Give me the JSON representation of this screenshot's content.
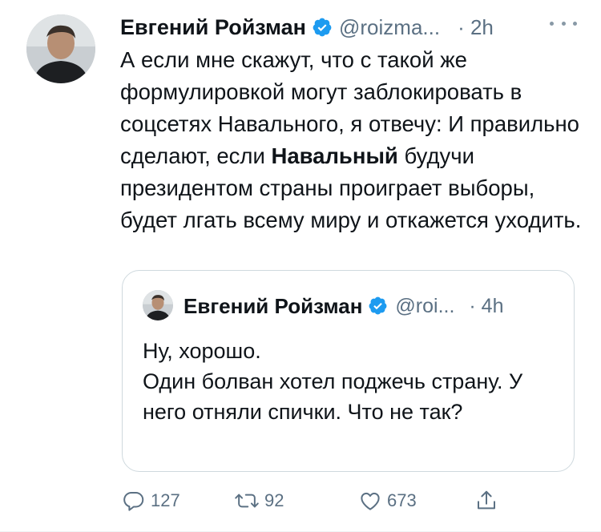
{
  "tweet": {
    "author_name": "Евгений Ройзман",
    "handle": "@roizma...",
    "time": "· 2h",
    "text_before": "А если мне скажут, что с такой же формулировкой  могут заблокировать в соцсетях Навального, я отвечу: И правильно сделают, если ",
    "text_bold": "Навальный",
    "text_after": " будучи президентом страны проиграет выборы, будет лгать всему миру и откажется уходить."
  },
  "quote": {
    "author_name": "Евгений Ройзман",
    "handle": "@roi...",
    "time": "· 4h",
    "text": "Ну, хорошо.\nОдин болван хотел  поджечь страну. У него отняли спички. Что не так?"
  },
  "actions": {
    "reply_count": "127",
    "retweet_count": "92",
    "like_count": "673"
  },
  "colors": {
    "verified": "#1d9bf0",
    "secondary_text": "#5b7083"
  },
  "icons": [
    "verified-badge-icon",
    "more-icon",
    "reply-icon",
    "retweet-icon",
    "like-icon",
    "share-icon"
  ]
}
